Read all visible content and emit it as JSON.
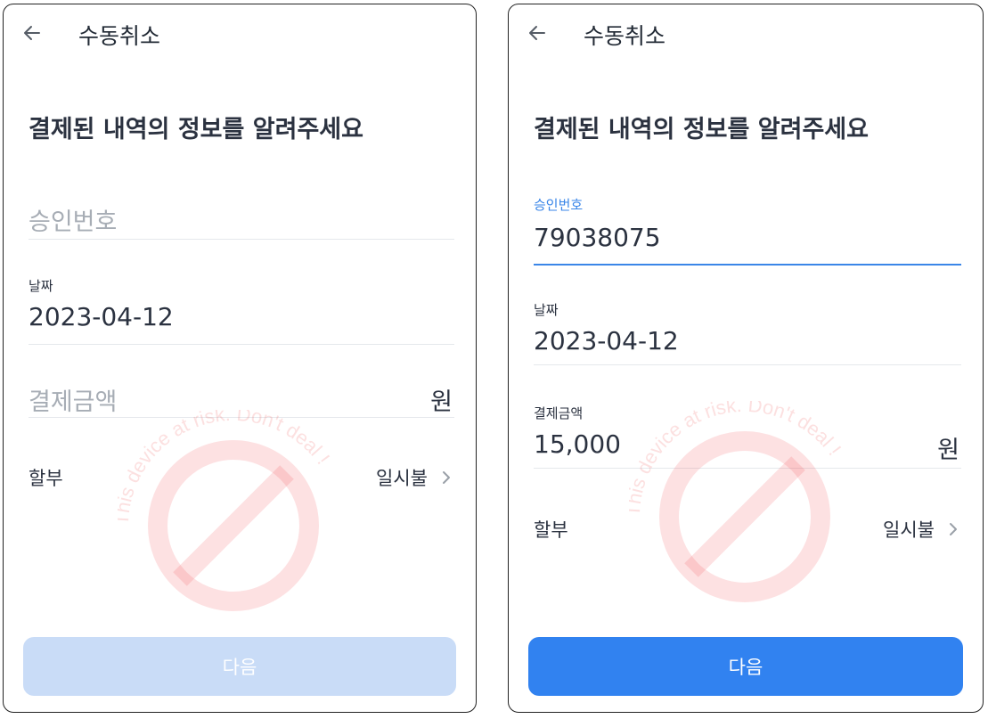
{
  "screens": [
    {
      "title": "수동취소",
      "heading": "결제된 내역의 정보를 알려주세요",
      "approval": {
        "placeholder": "승인번호"
      },
      "date": {
        "label": "날짜",
        "value": "2023-04-12"
      },
      "amount": {
        "placeholder": "결제금액",
        "unit": "원"
      },
      "installment": {
        "label": "할부",
        "value": "일시불"
      },
      "next_button": {
        "label": "다음",
        "state": "disabled"
      }
    },
    {
      "title": "수동취소",
      "heading": "결제된 내역의 정보를 알려주세요",
      "approval": {
        "label": "승인번호",
        "value": "79038075"
      },
      "date": {
        "label": "날짜",
        "value": "2023-04-12"
      },
      "amount": {
        "label": "결제금액",
        "value": "15,000",
        "unit": "원"
      },
      "installment": {
        "label": "할부",
        "value": "일시불"
      },
      "next_button": {
        "label": "다음",
        "state": "enabled"
      }
    }
  ],
  "watermark": {
    "text": "This device at risk. Don't deal !"
  },
  "colors": {
    "accent": "#3182f0",
    "focus": "#3a86e8",
    "disabled_button": "#c9dcf7",
    "watermark": "#f0474a"
  },
  "icons": [
    "back-arrow-icon",
    "chevron-right-icon",
    "prohibited-icon"
  ]
}
